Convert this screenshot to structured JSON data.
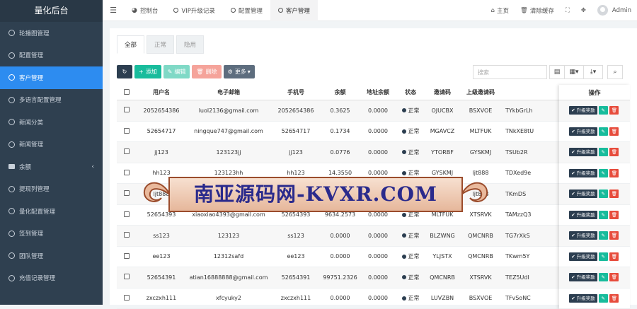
{
  "app": {
    "brand": "量化后台"
  },
  "sidebar": {
    "items": [
      {
        "label": "轮播图管理",
        "icon": "circle-icon"
      },
      {
        "label": "配置管理",
        "icon": "circle-icon"
      },
      {
        "label": "客户管理",
        "icon": "circle-icon",
        "active": true
      },
      {
        "label": "多语言配置管理",
        "icon": "circle-icon"
      },
      {
        "label": "新闻分类",
        "icon": "circle-icon"
      },
      {
        "label": "新闻管理",
        "icon": "circle-icon"
      },
      {
        "label": "余额",
        "icon": "list-icon",
        "caret": "‹"
      },
      {
        "label": "提现列管理",
        "icon": "circle-icon"
      },
      {
        "label": "量化配置管理",
        "icon": "circle-icon"
      },
      {
        "label": "签到管理",
        "icon": "circle-icon"
      },
      {
        "label": "团队管理",
        "icon": "circle-icon"
      },
      {
        "label": "充值记录管理",
        "icon": "circle-icon"
      }
    ]
  },
  "topbar": {
    "tabs": [
      {
        "label": "控制台",
        "icon": "dashboard-icon"
      },
      {
        "label": "VIP升级记录",
        "icon": "circle-icon"
      },
      {
        "label": "配置管理",
        "icon": "circle-icon"
      },
      {
        "label": "客户管理",
        "icon": "circle-icon",
        "active": true
      }
    ],
    "home": "主页",
    "clear_cache": "清除缓存",
    "user": "Admin"
  },
  "subtabs": [
    "全部",
    "正常",
    "隐用"
  ],
  "toolbar": {
    "add": "添加",
    "edit": "编辑",
    "delete": "删除",
    "more": "更多"
  },
  "search": {
    "placeholder": "搜索"
  },
  "table": {
    "headers": [
      "用户名",
      "电子邮箱",
      "手机号",
      "余额",
      "地址余额",
      "状态",
      "邀请码",
      "上级邀请码",
      ""
    ],
    "op_header": "操作",
    "op_buttons": {
      "upgrade": "✔ 升级奖励"
    },
    "rows": [
      [
        "2052654386",
        "luol2136@gmail.com",
        "2052654386",
        "0.3625",
        "0.0000",
        "正常",
        "OJUCBX",
        "BSXVOE",
        "TYkbGrLh"
      ],
      [
        "52654717",
        "ningque747@gmail.com",
        "52654717",
        "0.1734",
        "0.0000",
        "正常",
        "MGAVCZ",
        "MLTFUK",
        "TNkXE8tU"
      ],
      [
        "jj123",
        "123123jj",
        "jj123",
        "0.0776",
        "0.0000",
        "正常",
        "YTORBF",
        "GYSKMJ",
        "TSUb2R"
      ],
      [
        "hh123",
        "123123hh",
        "hh123",
        "14.3550",
        "0.0000",
        "正常",
        "GYSKMJ",
        "ljt888",
        "TDXed9e"
      ],
      [
        "ljt888",
        "ljt888",
        "ljt888",
        "0.0000",
        "0.0000",
        "正常",
        "GYSKMJ",
        "ljt888",
        "TKmDS"
      ],
      [
        "52654393",
        "xiaoxiao4393@gmail.com",
        "52654393",
        "9634.2573",
        "0.0000",
        "正常",
        "MLTFUK",
        "XTSRVK",
        "TAMzzQ3"
      ],
      [
        "ss123",
        "123123",
        "ss123",
        "0.0000",
        "0.0000",
        "正常",
        "BLZWNG",
        "QMCNRB",
        "TG7rXkS"
      ],
      [
        "ee123",
        "12312safd",
        "ee123",
        "0.0000",
        "0.0000",
        "正常",
        "YLJSTX",
        "QMCNRB",
        "TKwm5Y"
      ],
      [
        "52654391",
        "atian16888888@gmail.com",
        "52654391",
        "99751.2326",
        "0.0000",
        "正常",
        "QMCNRB",
        "XTSRVK",
        "TEZ5UdI"
      ],
      [
        "zxczxh111",
        "xfcyuky2",
        "zxczxh111",
        "0.0000",
        "0.0000",
        "正常",
        "LUVZBN",
        "BSXVOE",
        "TFvSoNC"
      ]
    ]
  },
  "watermark": "南亚源码网-KVXR.COM"
}
